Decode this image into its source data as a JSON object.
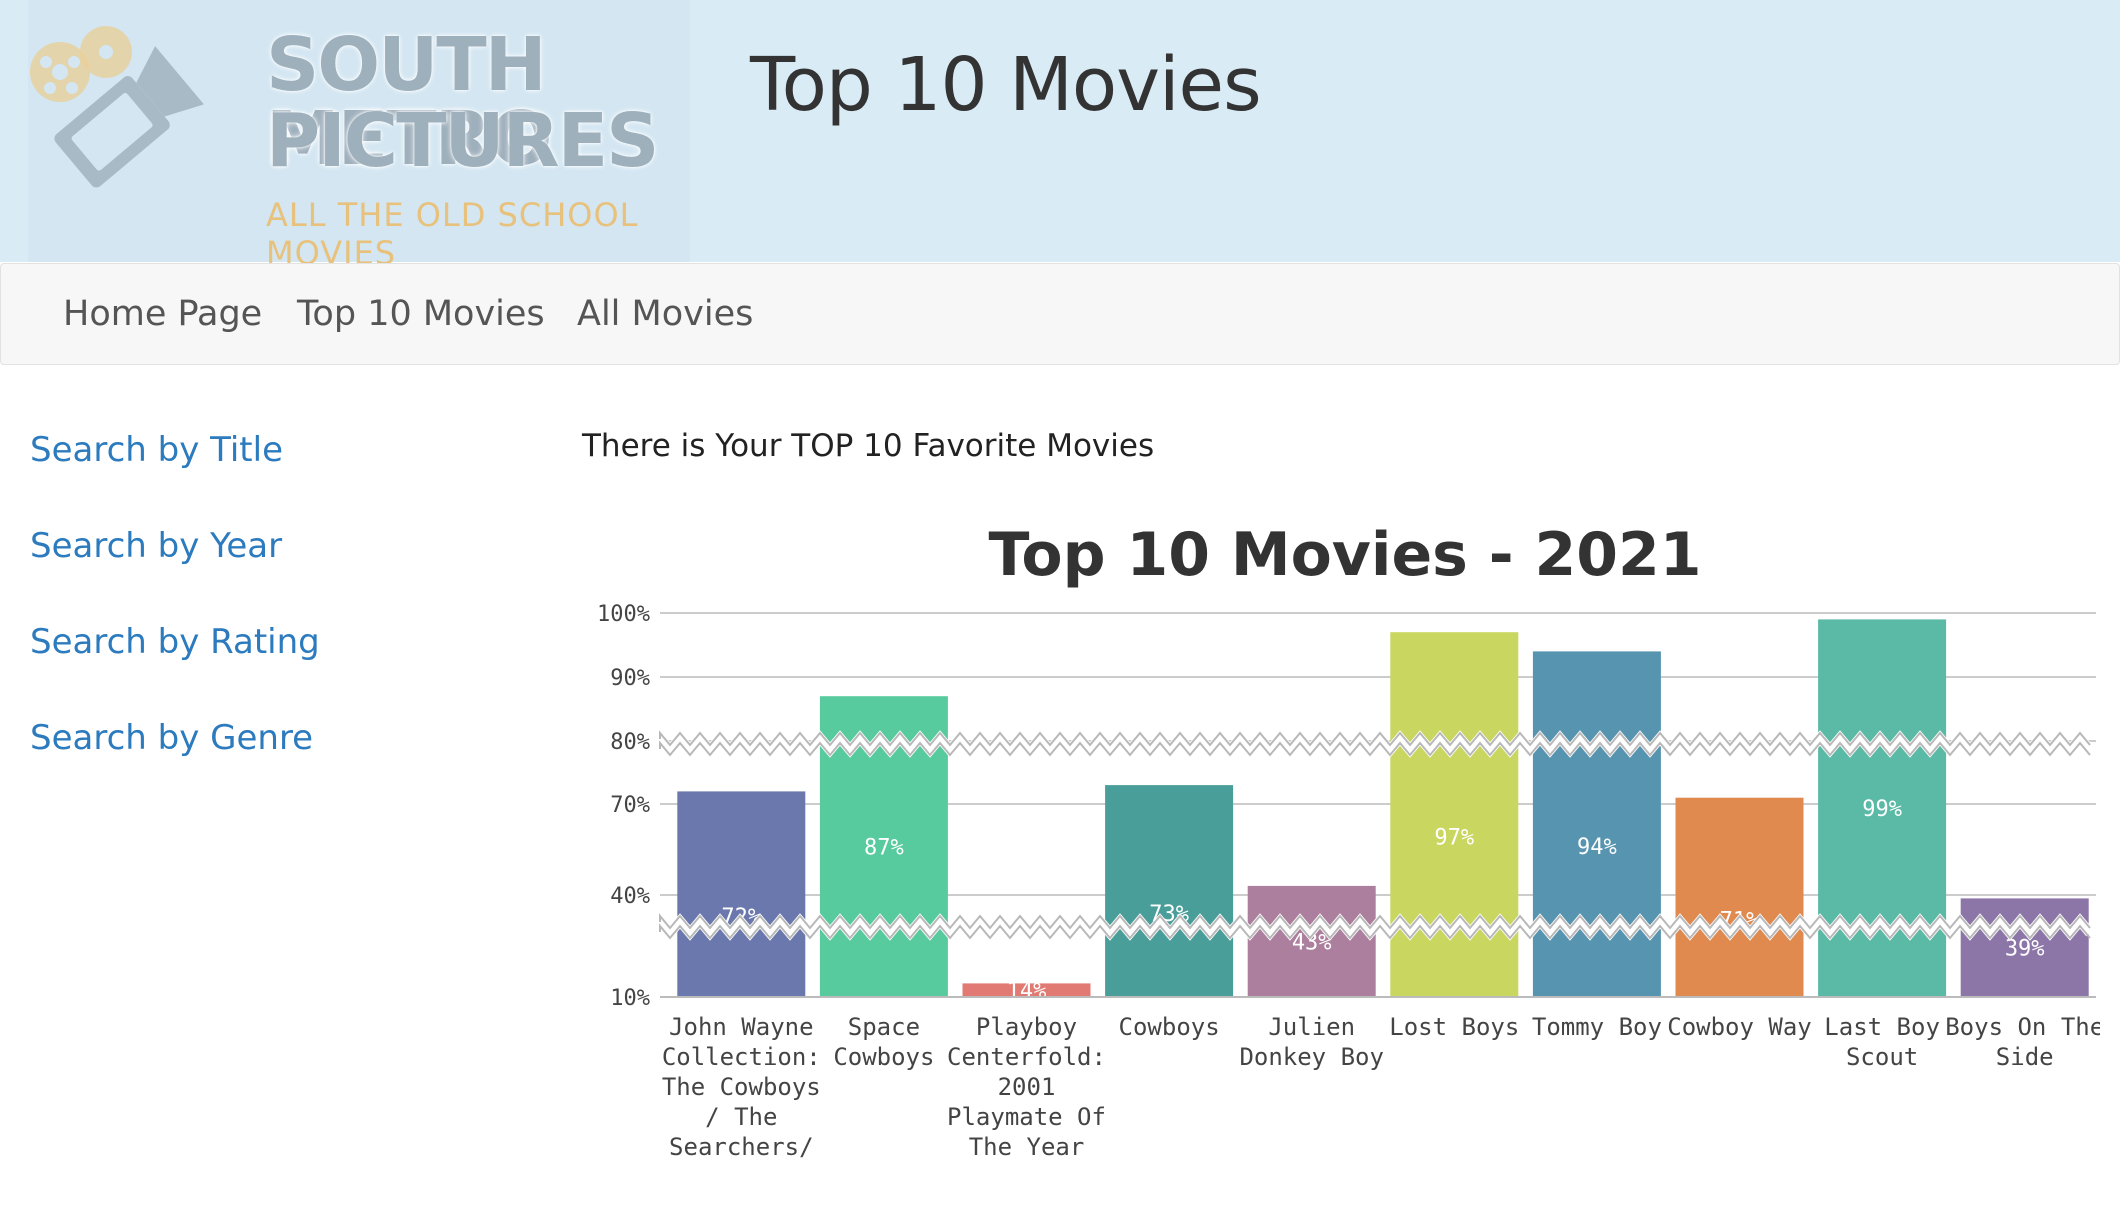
{
  "brand": {
    "line1": "SOUTH METRO",
    "line2": "PICTURES",
    "tagline": "ALL THE OLD SCHOOL MOVIES"
  },
  "header": {
    "title": "Top 10 Movies"
  },
  "nav": {
    "items": [
      "Home Page",
      "Top 10 Movies",
      "All Movies"
    ]
  },
  "sidebar": {
    "links": [
      "Search by Title",
      "Search by Year",
      "Search by Rating",
      "Search by Genre"
    ]
  },
  "main": {
    "intro": "There is Your TOP 10 Favorite Movies"
  },
  "chart_data": {
    "type": "bar",
    "title": "Top 10 Movies - 2021",
    "categories": [
      "John Wayne Collection: The Cowboys / The Searchers/",
      "Space Cowboys",
      "Playboy Centerfold: 2001 Playmate Of The Year",
      "Cowboys",
      "Julien Donkey Boy",
      "Lost Boys",
      "Tommy Boy",
      "Cowboy Way",
      "Last Boy Scout",
      "Boys On The Side"
    ],
    "values": [
      72,
      87,
      14,
      73,
      43,
      97,
      94,
      71,
      99,
      39
    ],
    "data_labels": [
      "72%",
      "87%",
      "14%",
      "73%",
      "43%",
      "97%",
      "94%",
      "71%",
      "99%",
      "39%"
    ],
    "colors": [
      "#6b78ad",
      "#57cb9e",
      "#e07a72",
      "#4a9e9a",
      "#ad7f9e",
      "#c9d660",
      "#5694b0",
      "#e08a50",
      "#5abaa6",
      "#8c76a8"
    ],
    "y_ticks": [
      "10%",
      "40%",
      "70%",
      "80%",
      "90%",
      "100%"
    ],
    "ylim": [
      10,
      100
    ],
    "axis_breaks": [
      [
        10,
        40
      ],
      [
        40,
        70
      ]
    ],
    "grid": true,
    "legend": "none"
  }
}
